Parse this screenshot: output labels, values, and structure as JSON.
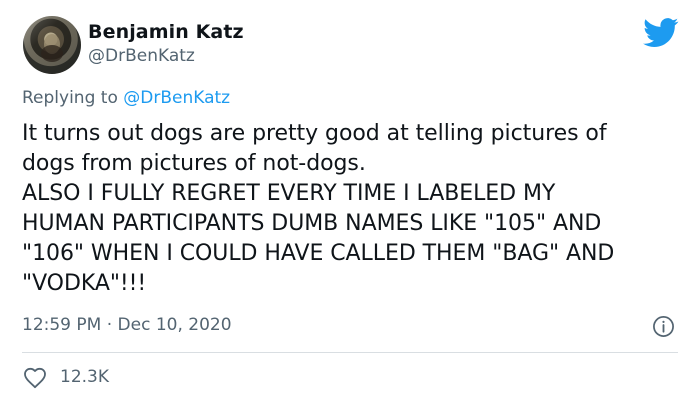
{
  "tweet": {
    "author": {
      "name": "Benjamin Katz",
      "handle": "@DrBenKatz"
    },
    "reply": {
      "prefix": "Replying to ",
      "handle": "@DrBenKatz"
    },
    "text_lines": [
      "It turns out dogs are pretty good at telling pictures of",
      "dogs from pictures of not-dogs.",
      "ALSO I FULLY REGRET EVERY TIME I LABELED MY",
      "HUMAN PARTICIPANTS DUMB NAMES LIKE \"105\" AND",
      "\"106\" WHEN I COULD HAVE CALLED THEM \"BAG\" AND",
      "\"VODKA\"!!!"
    ],
    "meta": {
      "time": "12:59 PM",
      "separator": " · ",
      "date": "Dec 10, 2020"
    },
    "stats": {
      "likes": "12.3K"
    }
  },
  "icons": {
    "logo": "twitter-bird-icon",
    "info": "info-circle-icon",
    "like": "heart-outline-icon"
  },
  "colors": {
    "text": "#0f1419",
    "secondary": "#536471",
    "accent": "#1d9bf0",
    "divider": "#d9dee2"
  }
}
